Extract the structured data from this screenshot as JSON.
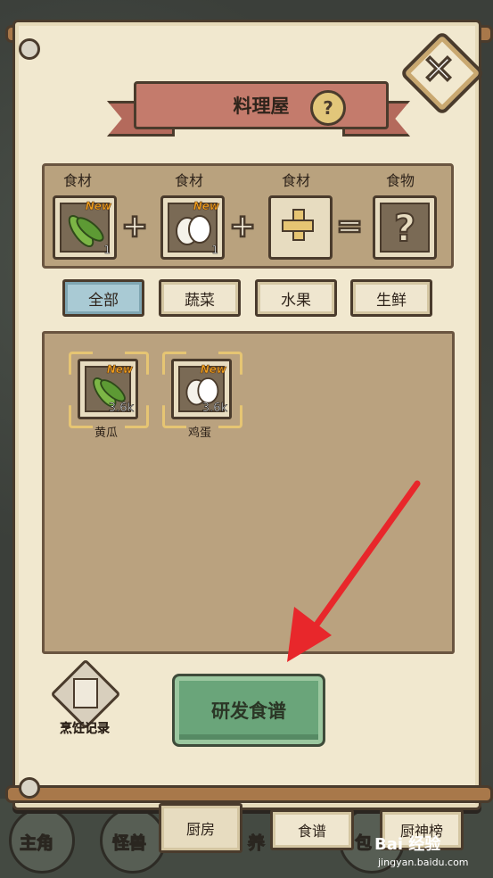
{
  "header": {
    "title": "料理屋",
    "help": "?",
    "close": "✕"
  },
  "recipe": {
    "slots": [
      {
        "label": "食材",
        "item": "cucumber",
        "new": "New",
        "count": "1"
      },
      {
        "label": "食材",
        "item": "egg",
        "new": "New",
        "count": "1"
      },
      {
        "label": "食材",
        "item": "empty-slot",
        "new": "",
        "count": ""
      },
      {
        "label": "食物",
        "item": "unknown",
        "new": "",
        "count": ""
      }
    ],
    "operators": [
      "+",
      "+",
      "="
    ],
    "result_placeholder": "?"
  },
  "filters": [
    {
      "label": "全部",
      "active": true
    },
    {
      "label": "蔬菜",
      "active": false
    },
    {
      "label": "水果",
      "active": false
    },
    {
      "label": "生鲜",
      "active": false
    }
  ],
  "inventory": [
    {
      "name": "黄瓜",
      "qty": "3.6k",
      "new": "New",
      "icon": "cucumber-icon"
    },
    {
      "name": "鸡蛋",
      "qty": "3.6k",
      "new": "New",
      "icon": "egg-icon"
    }
  ],
  "actions": {
    "cooking_log": "烹饪记录",
    "research": "研发食谱"
  },
  "bottom_nav": {
    "background_labels": [
      "主角",
      "怪兽",
      "养",
      "包"
    ],
    "tabs": [
      {
        "label": "厨房",
        "active": true
      },
      {
        "label": "食谱",
        "active": false
      },
      {
        "label": "厨神榜",
        "active": false
      }
    ]
  },
  "watermark": {
    "text": "Bai 经验",
    "sub": "jingyan.baidu.com"
  },
  "colors": {
    "paper": "#f1e8cf",
    "banner": "#c47b6c",
    "research_button": "#6aa57a",
    "active_tab": "#a9cad4",
    "new_tag": "#f3a21f",
    "arrow": "#e8272b"
  }
}
